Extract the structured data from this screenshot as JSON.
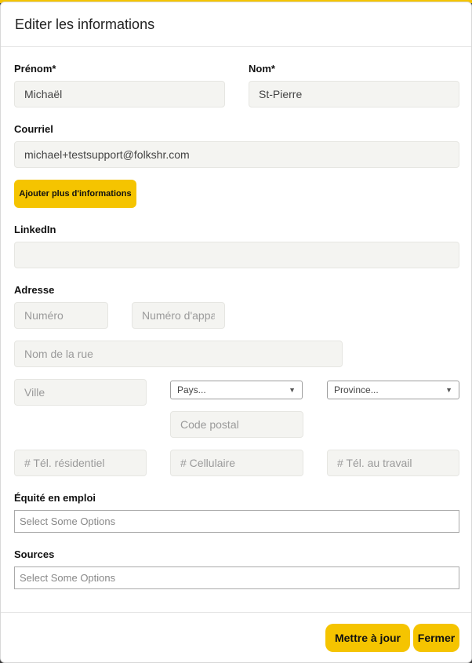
{
  "modal": {
    "title": "Editer les informations"
  },
  "form": {
    "prenom": {
      "label": "Prénom*",
      "value": "Michaël"
    },
    "nom": {
      "label": "Nom*",
      "value": "St-Pierre"
    },
    "courriel": {
      "label": "Courriel",
      "value": "michael+testsupport@folkshr.com"
    },
    "more_info_button": "Ajouter plus d'informations",
    "linkedin": {
      "label": "LinkedIn",
      "value": ""
    },
    "adresse": {
      "label": "Adresse",
      "numero_placeholder": "Numéro",
      "appartement_placeholder": "Numéro d'appartement",
      "rue_placeholder": "Nom de la rue",
      "ville_placeholder": "Ville",
      "pays_selected": "Pays...",
      "province_selected": "Province...",
      "code_postal_placeholder": "Code postal"
    },
    "phones": {
      "residentiel_placeholder": "# Tél. résidentiel",
      "cellulaire_placeholder": "# Cellulaire",
      "travail_placeholder": "# Tél. au travail"
    },
    "equite": {
      "label": "Équité en emploi",
      "placeholder": "Select Some Options"
    },
    "sources": {
      "label": "Sources",
      "placeholder": "Select Some Options"
    }
  },
  "footer": {
    "update_button": "Mettre à jour",
    "close_button": "Fermer"
  },
  "colors": {
    "accent": "#f5c400",
    "field_bg": "#f4f4f1"
  }
}
